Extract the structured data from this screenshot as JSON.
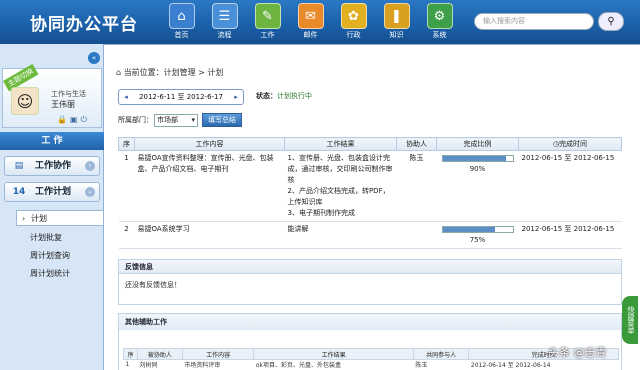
{
  "header": {
    "title": "协同办公平台",
    "nav": [
      {
        "label": "首页",
        "icon": "home-icon",
        "glyph": "⌂",
        "color": "#3a7fd0"
      },
      {
        "label": "流程",
        "icon": "workflow-icon",
        "glyph": "☰",
        "color": "#4a90d9"
      },
      {
        "label": "工作",
        "icon": "work-icon",
        "glyph": "✎",
        "color": "#6db33f"
      },
      {
        "label": "邮件",
        "icon": "mail-icon",
        "glyph": "✉",
        "color": "#e88a2a"
      },
      {
        "label": "行政",
        "icon": "admin-icon",
        "glyph": "✿",
        "color": "#e0b020"
      },
      {
        "label": "知识",
        "icon": "knowledge-icon",
        "glyph": "❚",
        "color": "#d9a020"
      },
      {
        "label": "系统",
        "icon": "system-icon",
        "glyph": "⚙",
        "color": "#3fa04a"
      }
    ],
    "search_placeholder": "输入搜索内容"
  },
  "sidebar": {
    "badge": "主题切换",
    "user_dept": "工作与生活",
    "user_name": "王伟丽",
    "work_tab": "工 作",
    "groups": [
      {
        "label": "工作协作"
      },
      {
        "label": "工作计划"
      }
    ],
    "sub_items": [
      "计划",
      "计划批复",
      "周计划查询",
      "周计划统计"
    ]
  },
  "main": {
    "breadcrumb": "当前位置：计划管理 > 计划",
    "date_range": "2012-6-11 至 2012-6-17",
    "status_label": "状态：",
    "status_value": "计划执行中",
    "dept_label": "所属部门：",
    "dept_value": "市场部",
    "fill_button": "填写总结",
    "columns": [
      "序",
      "工作内容",
      "工作结果",
      "协助人",
      "完成比例",
      "完成时间"
    ],
    "rows": [
      {
        "no": "1",
        "content": "易捷OA宣传资料整理：宣传册、光盘、包装盒、产品介绍文档、电子期刊",
        "result": "1、宣传册、光盘、包装盒设计完成，通过审核，交印刷公司制作审核\n2、产品介绍文档完成，转PDF，上传知识库\n3、电子期刊制作完成",
        "helper": "陈玉",
        "pct_text": "90%",
        "pct": 90,
        "time": "2012-06-15 至 2012-06-15"
      },
      {
        "no": "2",
        "content": "易捷OA系统学习",
        "result": "能讲解",
        "helper": "",
        "pct_text": "75%",
        "pct": 75,
        "time": "2012-06-15 至 2012-06-15"
      }
    ],
    "feedback_title": "反馈信息",
    "feedback_text": "还没有反馈信息！",
    "other_title": "其他辅助工作",
    "other_columns": [
      "序",
      "被协助人",
      "工作内容",
      "工作结果",
      "共同参与人",
      "完成时间"
    ],
    "other_row": [
      "1",
      "刘树同",
      "市场资料评审",
      "ok项目、彩页、光盘、外包装盒",
      "陈玉",
      "2012-06-14 至 2012-06-14"
    ]
  },
  "quick_menu": "快捷菜单",
  "watermark": "头条 @志青"
}
